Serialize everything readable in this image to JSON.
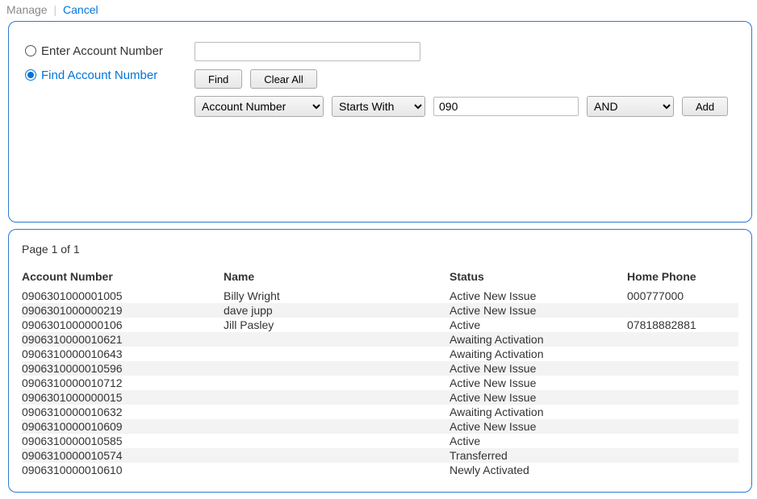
{
  "top": {
    "manage": "Manage",
    "divider": "|",
    "cancel": "Cancel"
  },
  "radios": {
    "enter": "Enter Account Number",
    "find": "Find Account Number"
  },
  "buttons": {
    "find": "Find",
    "clear": "Clear All",
    "add": "Add"
  },
  "filter": {
    "field_options": [
      "Account Number"
    ],
    "field_selected": "Account Number",
    "op_options": [
      "Starts With"
    ],
    "op_selected": "Starts With",
    "value": "090",
    "bool_options": [
      "AND"
    ],
    "bool_selected": "AND"
  },
  "page_info": "Page 1 of 1",
  "columns": {
    "acct": "Account Number",
    "name": "Name",
    "status": "Status",
    "phone": "Home Phone"
  },
  "rows": [
    {
      "acct": "0906301000001005",
      "name": "Billy Wright",
      "status": "Active New Issue",
      "phone": "000777000"
    },
    {
      "acct": "0906301000000219",
      "name": "dave jupp",
      "status": "Active New Issue",
      "phone": ""
    },
    {
      "acct": "0906301000000106",
      "name": "Jill Pasley",
      "status": "Active",
      "phone": "07818882881"
    },
    {
      "acct": "0906310000010621",
      "name": "",
      "status": "Awaiting Activation",
      "phone": ""
    },
    {
      "acct": "0906310000010643",
      "name": "",
      "status": "Awaiting Activation",
      "phone": ""
    },
    {
      "acct": "0906310000010596",
      "name": "",
      "status": "Active New Issue",
      "phone": ""
    },
    {
      "acct": "0906310000010712",
      "name": "",
      "status": "Active New Issue",
      "phone": ""
    },
    {
      "acct": "0906301000000015",
      "name": "",
      "status": "Active New Issue",
      "phone": ""
    },
    {
      "acct": "0906310000010632",
      "name": "",
      "status": "Awaiting Activation",
      "phone": ""
    },
    {
      "acct": "0906310000010609",
      "name": "",
      "status": "Active New Issue",
      "phone": ""
    },
    {
      "acct": "0906310000010585",
      "name": "",
      "status": "Active",
      "phone": ""
    },
    {
      "acct": "0906310000010574",
      "name": "",
      "status": "Transferred",
      "phone": ""
    },
    {
      "acct": "0906310000010610",
      "name": "",
      "status": "Newly Activated",
      "phone": ""
    }
  ]
}
